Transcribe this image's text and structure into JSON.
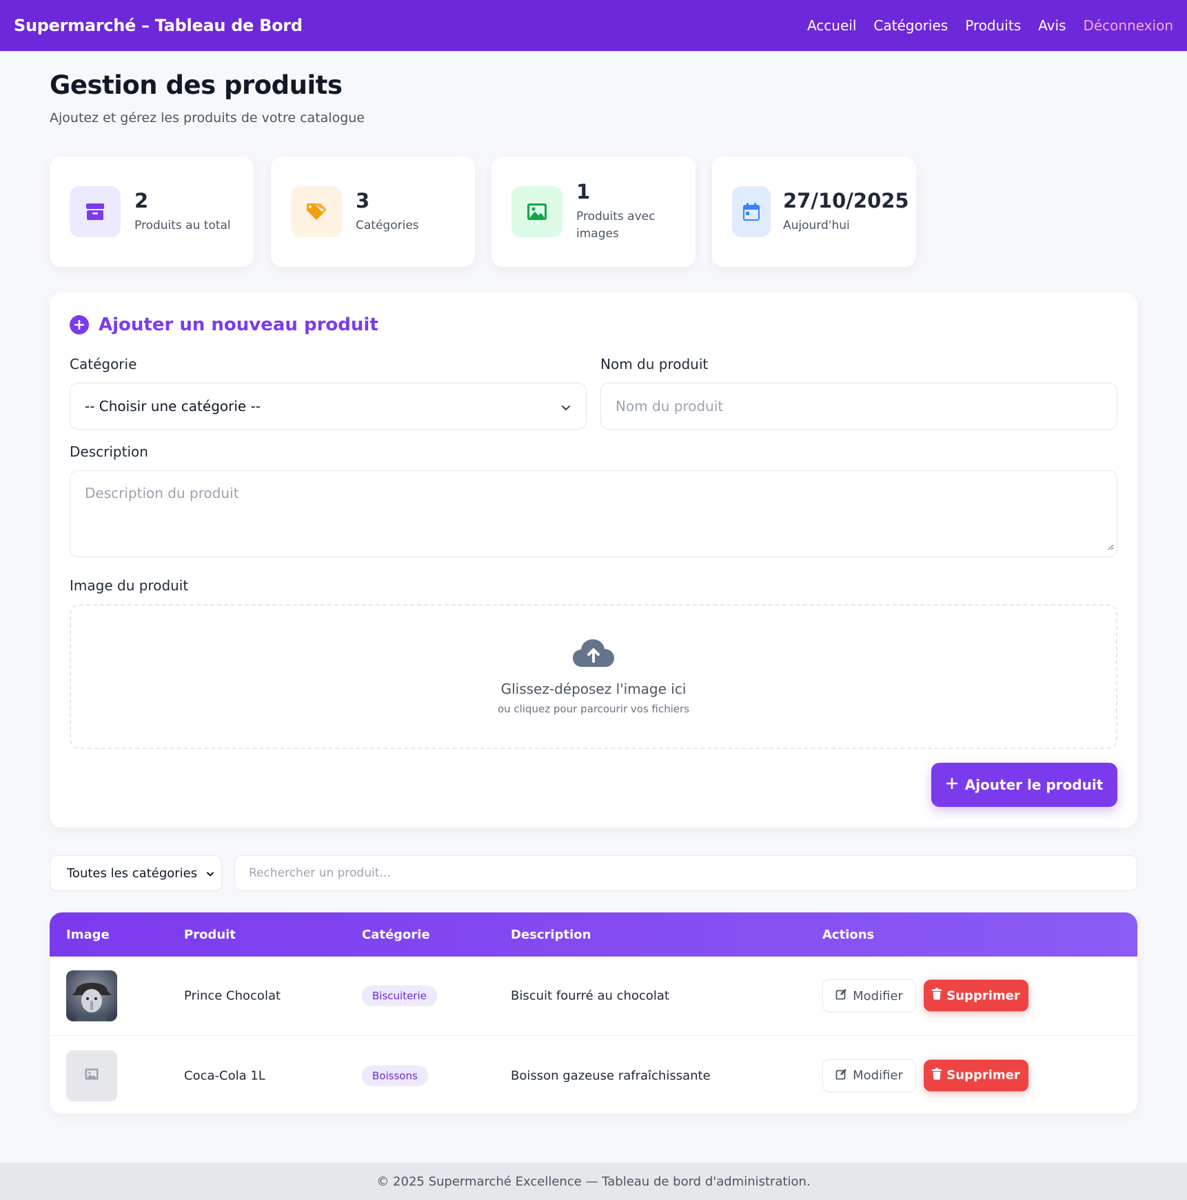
{
  "navbar": {
    "brand": "Supermarché – Tableau de Bord",
    "links": [
      "Accueil",
      "Catégories",
      "Produits",
      "Avis"
    ],
    "logout": "Déconnexion"
  },
  "header": {
    "title": "Gestion des produits",
    "subtitle": "Ajoutez et gérez les produits de votre catalogue"
  },
  "stats": [
    {
      "value": "2",
      "label": "Produits au total",
      "icon": "box-icon",
      "color": "#7c3aed",
      "bg": "#ede9fe"
    },
    {
      "value": "3",
      "label": "Catégories",
      "icon": "tags-icon",
      "color": "#f59e0b",
      "bg": "#fef3e2"
    },
    {
      "value": "1",
      "label": "Produits avec images",
      "icon": "image-icon",
      "color": "#16a34a",
      "bg": "#dcfce7"
    },
    {
      "value": "27/10/2025",
      "label": "Aujourd'hui",
      "icon": "calendar-icon",
      "color": "#3b82f6",
      "bg": "#e0ecfd"
    }
  ],
  "form": {
    "heading": "Ajouter un nouveau produit",
    "category_label": "Catégorie",
    "category_value": "-- Choisir une catégorie --",
    "name_label": "Nom du produit",
    "name_placeholder": "Nom du produit",
    "description_label": "Description",
    "description_placeholder": "Description du produit",
    "image_label": "Image du produit",
    "dropzone_main": "Glissez-déposez l'image ici",
    "dropzone_sub": "ou cliquez pour parcourir vos fichiers",
    "submit": "Ajouter le produit"
  },
  "filters": {
    "category_value": "Toutes les catégories",
    "search_placeholder": "Rechercher un produit..."
  },
  "table": {
    "columns": [
      "Image",
      "Produit",
      "Catégorie",
      "Description",
      "Actions"
    ],
    "rows": [
      {
        "product": "Prince Chocolat",
        "category": "Biscuiterie",
        "description": "Biscuit fourré au chocolat",
        "has_image": true
      },
      {
        "product": "Coca-Cola 1L",
        "category": "Boissons",
        "description": "Boisson gazeuse rafraîchissante",
        "has_image": false
      }
    ],
    "edit_label": "Modifier",
    "delete_label": "Supprimer"
  },
  "colors": {
    "primary": "#7c3aed",
    "navbar": "#6d28d9",
    "danger": "#ef4444"
  },
  "footer": {
    "text": "© 2025 Supermarché Excellence — Tableau de bord d'administration."
  }
}
